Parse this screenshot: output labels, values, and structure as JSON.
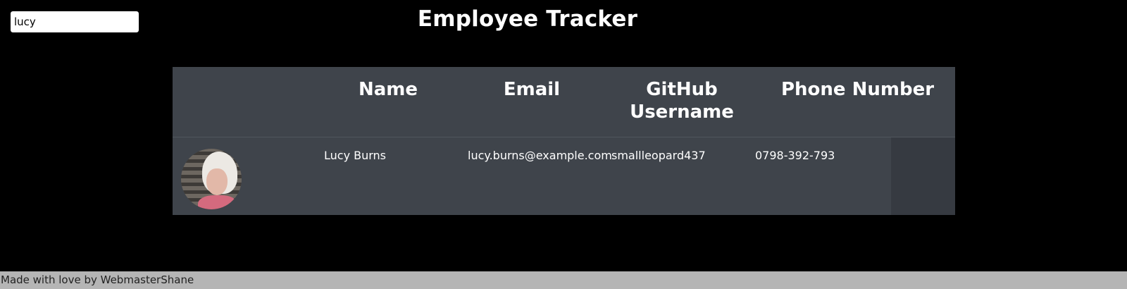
{
  "search": {
    "value": "lucy"
  },
  "header": {
    "title": "Employee Tracker"
  },
  "table": {
    "columns": {
      "image": "",
      "name": "Name",
      "email": "Email",
      "github": "GitHub Username",
      "phone": "Phone Number"
    },
    "rows": [
      {
        "name": "Lucy Burns",
        "email": "lucy.burns@example.com",
        "github": "smallleopard437",
        "phone": "0798-392-793",
        "avatar_icon": "user-photo"
      }
    ]
  },
  "footer": {
    "text": "Made with love by WebmasterShane"
  },
  "colors": {
    "background": "#000000",
    "table_bg": "#3f444b",
    "footer_bg": "#b5b5b5"
  }
}
